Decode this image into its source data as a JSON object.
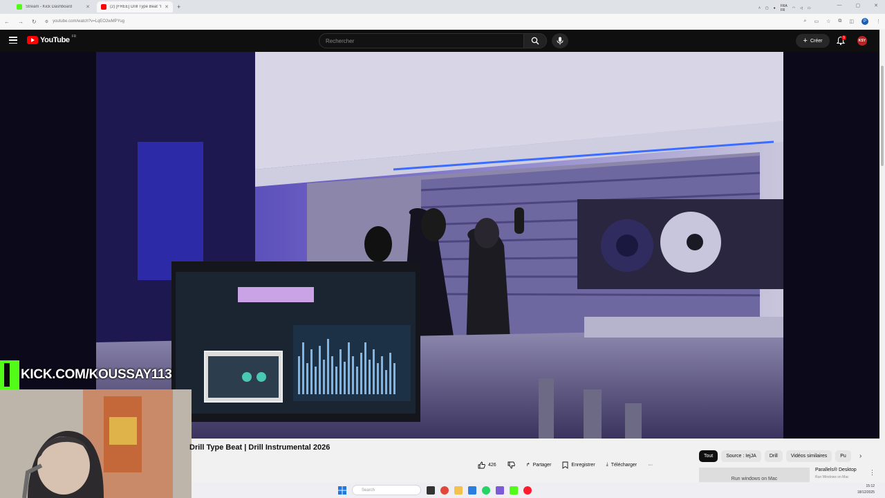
{
  "browser": {
    "tabs": [
      {
        "title": "Stream - Kick Dashboard",
        "favicon_color": "#53fc18"
      },
      {
        "title": "(2) [FREE] Drill Type Beat \"I",
        "favicon_color": "#ff0000"
      }
    ],
    "new_tab": "+",
    "url": "youtube.com/watch?v=LqEO2wMPYug"
  },
  "youtube": {
    "logo_text": "YouTube",
    "region": "FR",
    "search_placeholder": "Rechercher",
    "create_label": "Créer",
    "notifications_count": "9",
    "avatar_text": "KSY"
  },
  "video": {
    "title": "Drill Type Beat | Drill Instrumental 2026",
    "likes": "426",
    "share_label": "Partager",
    "save_label": "Enregistrer",
    "download_label": "Télécharger",
    "more_label": "···"
  },
  "overlay": {
    "kick_url": "KICK.COM/KOUSSAY113"
  },
  "chips": [
    "Tout",
    "Source : IejJA",
    "Drill",
    "Vidéos similaires",
    "Pu"
  ],
  "ad": {
    "thumb_text": "Run windows on Mac",
    "title": "Parallels® Desktop",
    "subtitle": "Run Windows on Mac"
  },
  "taskbar": {
    "search_placeholder": "Search",
    "lang_top": "FRA",
    "lang_bottom": "FR",
    "time": "15:12",
    "date": "18/12/2025"
  },
  "colors": {
    "youtube_red": "#ff0000",
    "kick_green": "#53fc18",
    "youtube_dark": "#0f0f0f"
  }
}
